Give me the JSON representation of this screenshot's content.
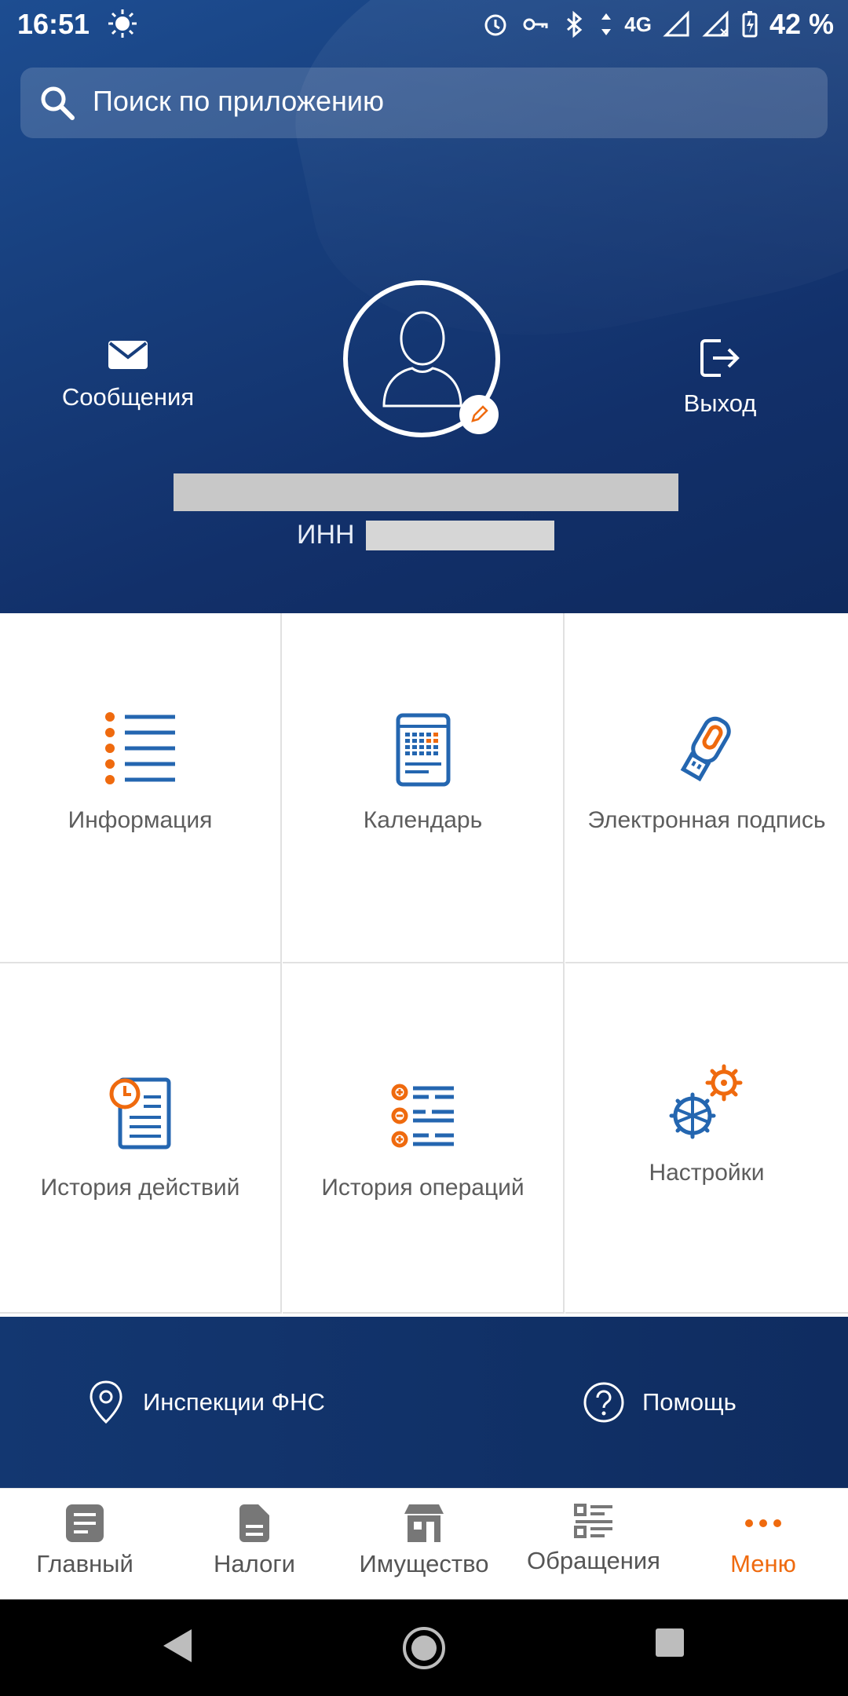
{
  "status_bar": {
    "time": "16:51",
    "network": "4G",
    "battery": "42 %"
  },
  "search": {
    "placeholder": "Поиск по приложению"
  },
  "profile": {
    "messages_label": "Сообщения",
    "logout_label": "Выход",
    "inn_label": "ИНН"
  },
  "grid": {
    "items": [
      {
        "label": "Информация",
        "icon": "list-icon"
      },
      {
        "label": "Календарь",
        "icon": "calendar-icon"
      },
      {
        "label": "Электронная подпись",
        "icon": "usb-key-icon"
      },
      {
        "label": "История действий",
        "icon": "document-clock-icon"
      },
      {
        "label": "История операций",
        "icon": "operations-icon"
      },
      {
        "label": "Настройки",
        "icon": "gears-icon"
      }
    ]
  },
  "footer_links": {
    "inspections": "Инспекции ФНС",
    "help": "Помощь"
  },
  "bottom_nav": {
    "tabs": [
      {
        "label": "Главный",
        "icon": "home-doc-icon"
      },
      {
        "label": "Налоги",
        "icon": "tax-doc-icon"
      },
      {
        "label": "Имущество",
        "icon": "property-icon"
      },
      {
        "label": "Обращения",
        "icon": "requests-icon"
      },
      {
        "label": "Меню",
        "icon": "dots-icon",
        "active": true
      }
    ]
  },
  "colors": {
    "primary_blue": "#173e7c",
    "accent_orange": "#ef6a0e",
    "icon_blue": "#2466b0"
  }
}
